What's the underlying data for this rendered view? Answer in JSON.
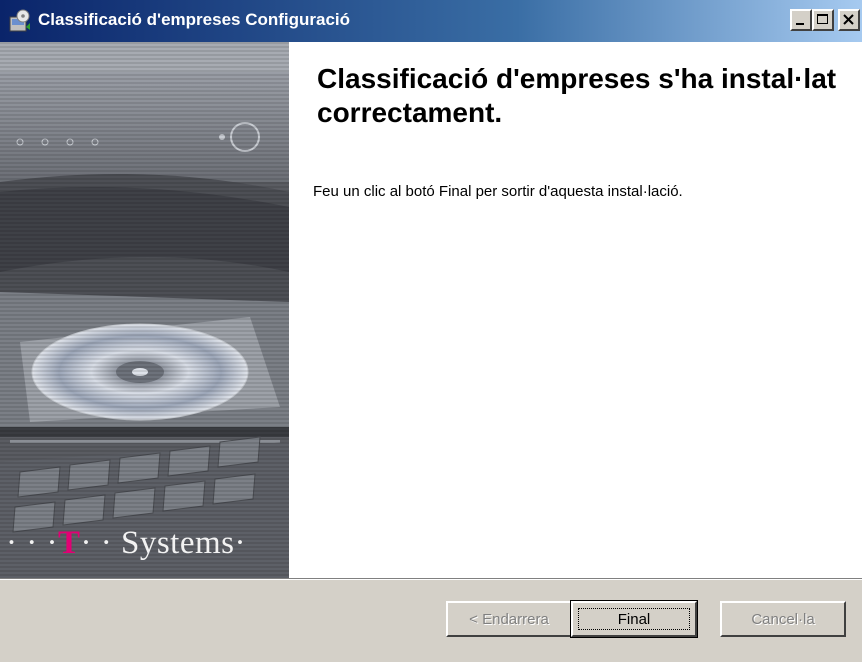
{
  "window": {
    "title": "Classificació d'empreses Configuració",
    "icon": "installer-icon",
    "controls": [
      "minimize-icon",
      "maximize-icon",
      "close-icon"
    ]
  },
  "banner": {
    "logo_prefix": "· · ·",
    "logo_t": "T",
    "logo_rest": "· · Systems·"
  },
  "main": {
    "heading": "Classificació d'empreses s'ha instal·lat correctament.",
    "body": "Feu un clic al botó Final per sortir d'aquesta instal·lació."
  },
  "buttons": {
    "back": {
      "label": "< Endarrera",
      "enabled": false
    },
    "finish": {
      "label": "Final",
      "enabled": true,
      "default": true
    },
    "cancel": {
      "label": "Cancel·la",
      "enabled": false
    }
  },
  "colors": {
    "title_bar_start": "#0a246a",
    "title_bar_end": "#a6caf0",
    "brand_magenta": "#e20074",
    "face": "#d4d0c8"
  }
}
